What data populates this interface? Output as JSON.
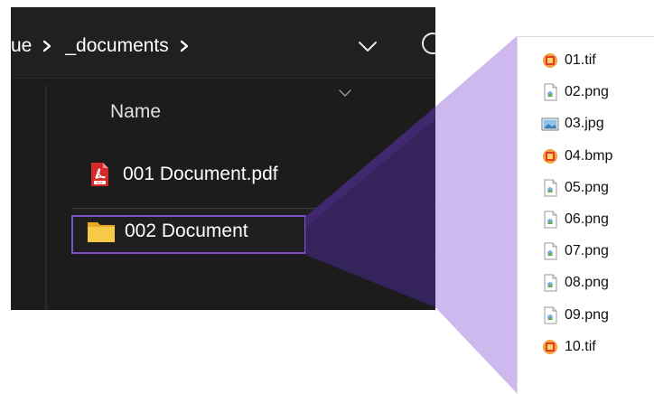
{
  "breadcrumb": {
    "items": [
      "ue",
      "_documents"
    ]
  },
  "file_list": {
    "column_header": "Name",
    "items": [
      {
        "name": "001 Document.pdf",
        "icon": "pdf-icon"
      },
      {
        "name": "002 Document",
        "icon": "folder-icon"
      }
    ]
  },
  "zoom_list": {
    "items": [
      {
        "name": "01.tif",
        "icon": "tif-icon"
      },
      {
        "name": "02.png",
        "icon": "png-icon"
      },
      {
        "name": "03.jpg",
        "icon": "jpg-icon"
      },
      {
        "name": "04.bmp",
        "icon": "bmp-icon"
      },
      {
        "name": "05.png",
        "icon": "png-icon"
      },
      {
        "name": "06.png",
        "icon": "png-icon"
      },
      {
        "name": "07.png",
        "icon": "png-icon"
      },
      {
        "name": "08.png",
        "icon": "png-icon"
      },
      {
        "name": "09.png",
        "icon": "png-icon"
      },
      {
        "name": "10.tif",
        "icon": "tif-icon"
      }
    ]
  },
  "colors": {
    "explorer_bg": "#1c1c1c",
    "highlight": "#7a4fc9",
    "wedge_light": "#cdb9ee",
    "wedge_dark": "#3a2466"
  }
}
